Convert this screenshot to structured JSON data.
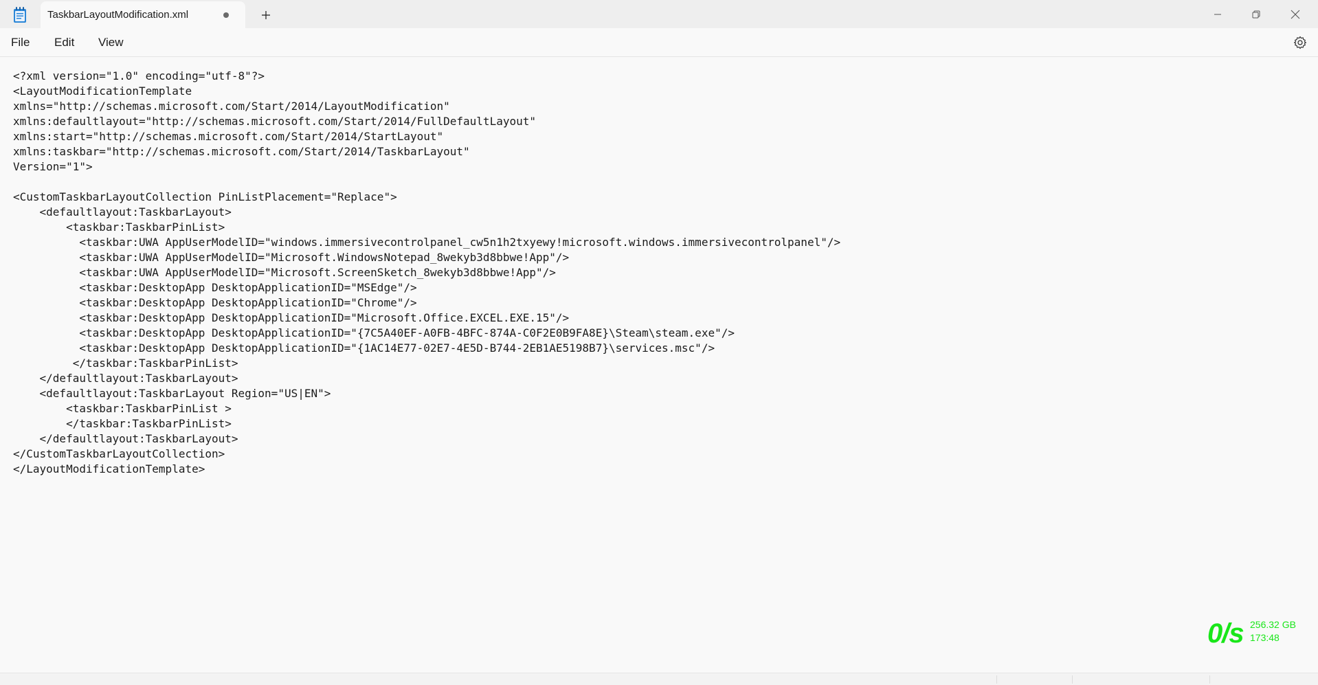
{
  "window": {
    "tab_title": "TaskbarLayoutModification.xml",
    "colors": {
      "titlebar": "#eeeeee",
      "editor_bg": "#f9f9f9",
      "overlay_green": "#19e619"
    },
    "icons": {
      "app": "notepad-icon",
      "new_tab": "plus-icon",
      "minimize": "minimize-icon",
      "maximize": "restore-icon",
      "close": "close-icon",
      "settings": "gear-icon",
      "unsaved": "unsaved-dot-icon"
    }
  },
  "menu": {
    "items": [
      {
        "label": "File"
      },
      {
        "label": "Edit"
      },
      {
        "label": "View"
      }
    ]
  },
  "editor": {
    "lines": [
      "<?xml version=\"1.0\" encoding=\"utf-8\"?>",
      "<LayoutModificationTemplate",
      "xmlns=\"http://schemas.microsoft.com/Start/2014/LayoutModification\"",
      "xmlns:defaultlayout=\"http://schemas.microsoft.com/Start/2014/FullDefaultLayout\"",
      "xmlns:start=\"http://schemas.microsoft.com/Start/2014/StartLayout\"",
      "xmlns:taskbar=\"http://schemas.microsoft.com/Start/2014/TaskbarLayout\"",
      "Version=\"1\">",
      "",
      "<CustomTaskbarLayoutCollection PinListPlacement=\"Replace\">",
      "    <defaultlayout:TaskbarLayout>",
      "        <taskbar:TaskbarPinList>",
      "          <taskbar:UWA AppUserModelID=\"windows.immersivecontrolpanel_cw5n1h2txyewy!microsoft.windows.immersivecontrolpanel\"/>",
      "          <taskbar:UWA AppUserModelID=\"Microsoft.WindowsNotepad_8wekyb3d8bbwe!App\"/>",
      "          <taskbar:UWA AppUserModelID=\"Microsoft.ScreenSketch_8wekyb3d8bbwe!App\"/>",
      "          <taskbar:DesktopApp DesktopApplicationID=\"MSEdge\"/>",
      "          <taskbar:DesktopApp DesktopApplicationID=\"Chrome\"/>",
      "          <taskbar:DesktopApp DesktopApplicationID=\"Microsoft.Office.EXCEL.EXE.15\"/>",
      "          <taskbar:DesktopApp DesktopApplicationID=\"{7C5A40EF-A0FB-4BFC-874A-C0F2E0B9FA8E}\\Steam\\steam.exe\"/>",
      "          <taskbar:DesktopApp DesktopApplicationID=\"{1AC14E77-02E7-4E5D-B744-2EB1AE5198B7}\\services.msc\"/>",
      "         </taskbar:TaskbarPinList>",
      "    </defaultlayout:TaskbarLayout>",
      "    <defaultlayout:TaskbarLayout Region=\"US|EN\">",
      "        <taskbar:TaskbarPinList >",
      "        </taskbar:TaskbarPinList>",
      "    </defaultlayout:TaskbarLayout>",
      "</CustomTaskbarLayoutCollection>",
      "</LayoutModificationTemplate>"
    ]
  },
  "overlay": {
    "speed": "0/s",
    "disk": "256.32 GB",
    "time": "173:48"
  }
}
